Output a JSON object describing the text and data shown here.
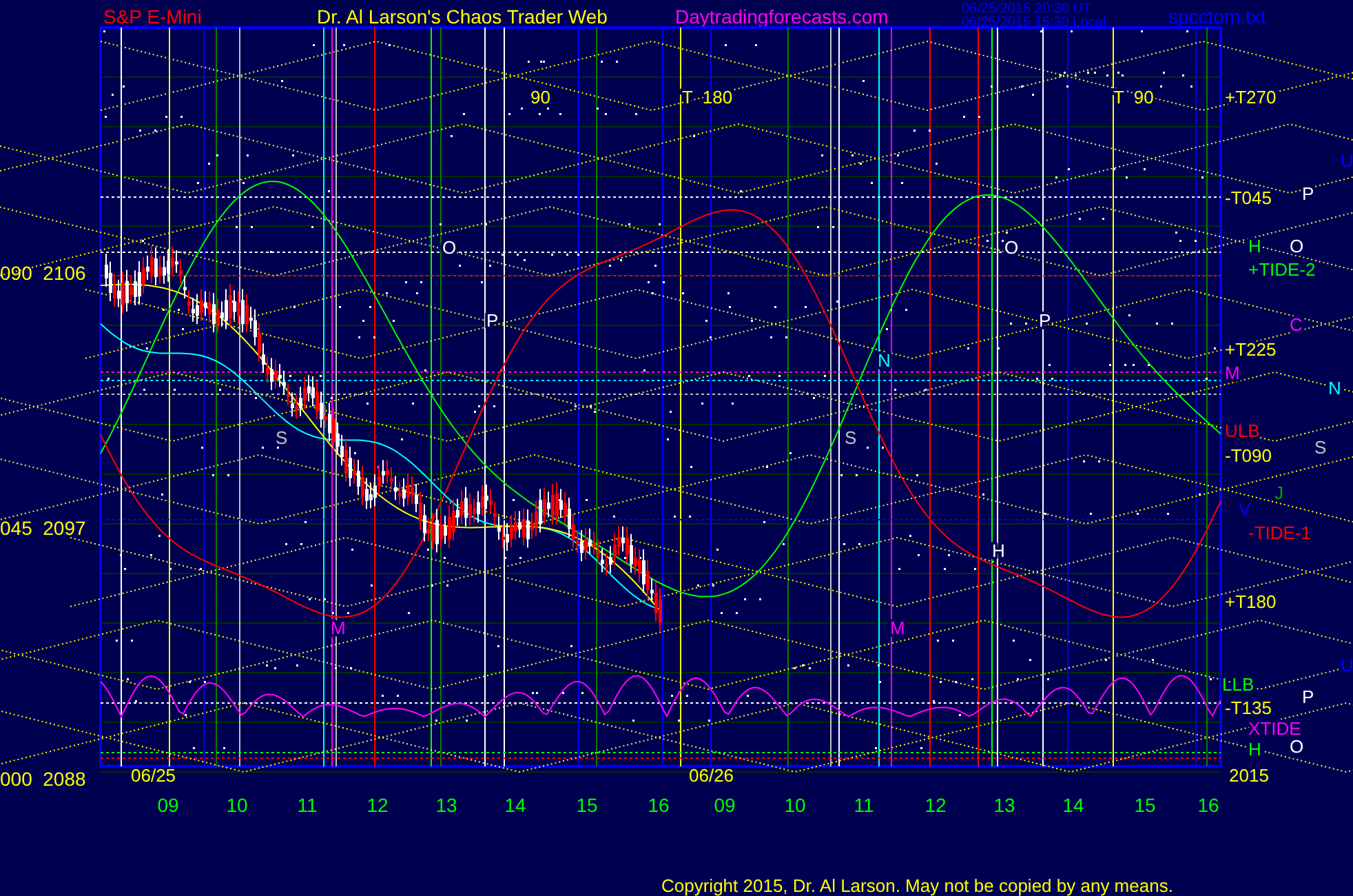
{
  "header": {
    "symbol": "S&P E-Mini",
    "title": "Dr. Al Larson's Chaos Trader Web",
    "website": "Daytradingforecasts.com",
    "timestamp_ut": "06/25/2015 20:30 UT",
    "timestamp_local": "06/25/2015 15:30 Local",
    "file": "spcctom.txt"
  },
  "chart": {
    "y_labels": [
      "090  2106",
      "045  2097",
      "000  2088"
    ],
    "date_labels": [
      "06/25",
      "06/26"
    ],
    "x_labels": [
      "09",
      "10",
      "11",
      "12",
      "13",
      "14",
      "15",
      "16",
      "09",
      "10",
      "11",
      "12",
      "13",
      "14",
      "15",
      "16"
    ],
    "markers": [
      {
        "text": "90",
        "color": "#ffff00"
      },
      {
        "text": "T  180",
        "color": "#ffff00"
      },
      {
        "text": "T  90",
        "color": "#ffff00"
      },
      {
        "text": "O",
        "color": "#ffffff"
      },
      {
        "text": "P",
        "color": "#ffffff"
      },
      {
        "text": "S",
        "color": "#c0c0c0"
      },
      {
        "text": "M",
        "color": "#ff00ff"
      },
      {
        "text": "O",
        "color": "#ffffff"
      },
      {
        "text": "P",
        "color": "#ffffff"
      },
      {
        "text": "N",
        "color": "#00ffff"
      },
      {
        "text": "S",
        "color": "#c0c0c0"
      },
      {
        "text": "M",
        "color": "#ff00ff"
      },
      {
        "text": "H",
        "color": "#ffffff"
      }
    ],
    "side_labels": [
      {
        "text": "+T270",
        "color": "#ffff00"
      },
      {
        "text": "U",
        "color": "#0000ff"
      },
      {
        "text": "-T045",
        "color": "#ffff00"
      },
      {
        "text": "P",
        "color": "#ffffff"
      },
      {
        "text": "H",
        "color": "#00ff00"
      },
      {
        "text": "O",
        "color": "#ffffff"
      },
      {
        "text": "+TIDE-2",
        "color": "#00ff00"
      },
      {
        "text": "C",
        "color": "#ff00ff"
      },
      {
        "text": "+T225",
        "color": "#ffff00"
      },
      {
        "text": "M",
        "color": "#ff00ff"
      },
      {
        "text": "N",
        "color": "#00ffff"
      },
      {
        "text": "ULB",
        "color": "#ff0000"
      },
      {
        "text": "-T090",
        "color": "#ffff00"
      },
      {
        "text": "S",
        "color": "#c0c0c0"
      },
      {
        "text": "J",
        "color": "#00a000"
      },
      {
        "text": "V",
        "color": "#0000ff"
      },
      {
        "text": "-TIDE-1",
        "color": "#ff0000"
      },
      {
        "text": "+T180",
        "color": "#ffff00"
      },
      {
        "text": "U",
        "color": "#0000ff"
      },
      {
        "text": "LLB",
        "color": "#00ff00"
      },
      {
        "text": "P",
        "color": "#ffffff"
      },
      {
        "text": "-T135",
        "color": "#ffff00"
      },
      {
        "text": "XTIDE",
        "color": "#ff00ff"
      },
      {
        "text": "H",
        "color": "#00ff00"
      },
      {
        "text": "O",
        "color": "#ffffff"
      },
      {
        "text": "2015",
        "color": "#ffff00"
      }
    ]
  },
  "copyright": "Copyright 2015, Dr. Al Larson. May not be copied by any means."
}
